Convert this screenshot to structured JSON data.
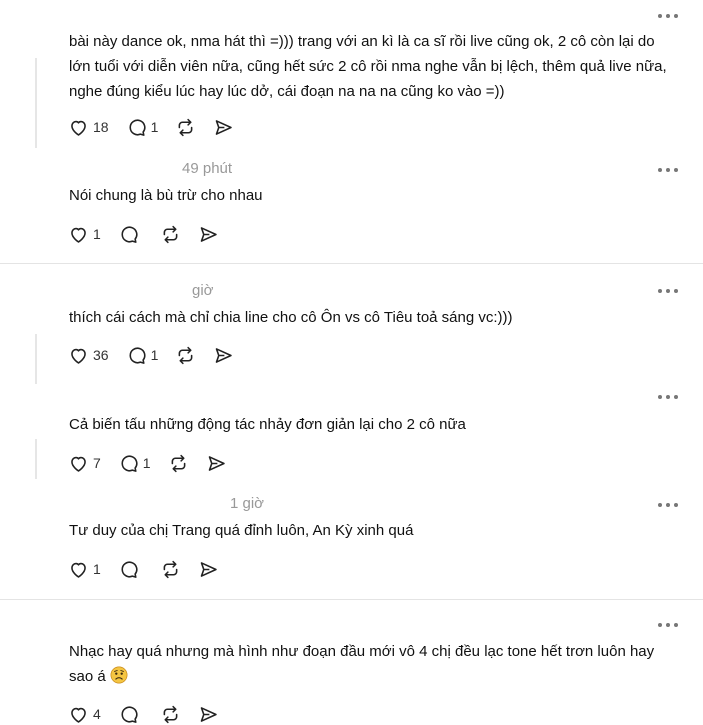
{
  "posts": [
    {
      "time": "",
      "text": "bài này dance ok, nma hát thì =))) trang với an kì là ca sĩ rồi live cũng ok, 2 cô còn lại do lớn tuổi với diễn viên nữa, cũng hết sức 2 cô rồi nma nghe vẫn bị lệch, thêm quả live nữa, nghe đúng kiểu lúc hay lúc dở, cái đoạn na na na cũng ko vào =))",
      "likes": "18",
      "replies": "1"
    },
    {
      "time": "49 phút",
      "text": "Nói chung là bù trừ cho nhau",
      "likes": "1",
      "replies": ""
    },
    {
      "time": "giờ",
      "text": "thích cái cách mà chỉ chia line cho cô Ôn vs cô Tiêu toả sáng vc:)))",
      "likes": "36",
      "replies": "1"
    },
    {
      "time": "",
      "text": "Cả biến tấu những động tác nhảy đơn giản lại cho 2 cô nữa",
      "likes": "7",
      "replies": "1"
    },
    {
      "time": "1 giờ",
      "text": "Tư duy của chị Trang quá đỉnh luôn, An Kỳ xinh quá",
      "likes": "1",
      "replies": ""
    },
    {
      "time": "",
      "text": "Nhạc hay quá nhưng mà hình như đoạn đầu mới vô 4 chị đều lạc tone hết trơn luôn hay sao á",
      "emoji": "😟",
      "likes": "4",
      "replies": ""
    }
  ],
  "icons": {
    "like": "heart-icon",
    "reply": "comment-icon",
    "repost": "repost-icon",
    "share": "send-icon",
    "more": "more-horizontal-icon"
  },
  "colors": {
    "text": "#111111",
    "muted": "#999999",
    "icon": "#222222",
    "divider": "#e4e4e4"
  }
}
